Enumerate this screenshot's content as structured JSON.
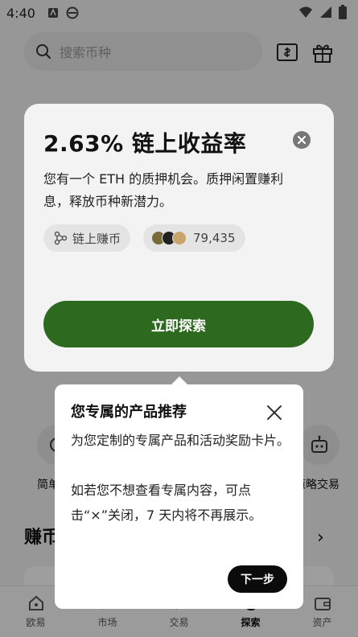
{
  "status_bar": {
    "time": "4:40"
  },
  "search": {
    "placeholder": "搜索币种"
  },
  "background": {
    "left_circle_label": "简单",
    "right_circle_label": "策略交易",
    "earn_section_title": "赚币",
    "earn_section_chevron": "›"
  },
  "promo_card": {
    "title": "2.63% 链上收益率",
    "description": "您有一个 ETH 的质押机会。质押闲置赚利息，释放币种新潜力。",
    "chip_left_label": "链上赚币",
    "chip_right_count": "79,435",
    "explore_button": "立即探索"
  },
  "tooltip": {
    "title": "您专属的产品推荐",
    "body_1": "为您定制的专属产品和活动奖励卡片。",
    "body_2": "如若您不想查看专属内容，可点击“×”关闭，7 天内将不再展示。",
    "next_button": "下一步"
  },
  "bottom_nav": {
    "items": [
      {
        "label": "欧易",
        "icon": "home-icon"
      },
      {
        "label": "市场",
        "icon": "market-icon"
      },
      {
        "label": "交易",
        "icon": "trade-icon"
      },
      {
        "label": "探索",
        "icon": "explore-icon"
      },
      {
        "label": "资产",
        "icon": "wallet-icon"
      }
    ]
  },
  "colors": {
    "accent_green": "#2d6a1f",
    "next_button": "#0b0b0b"
  }
}
